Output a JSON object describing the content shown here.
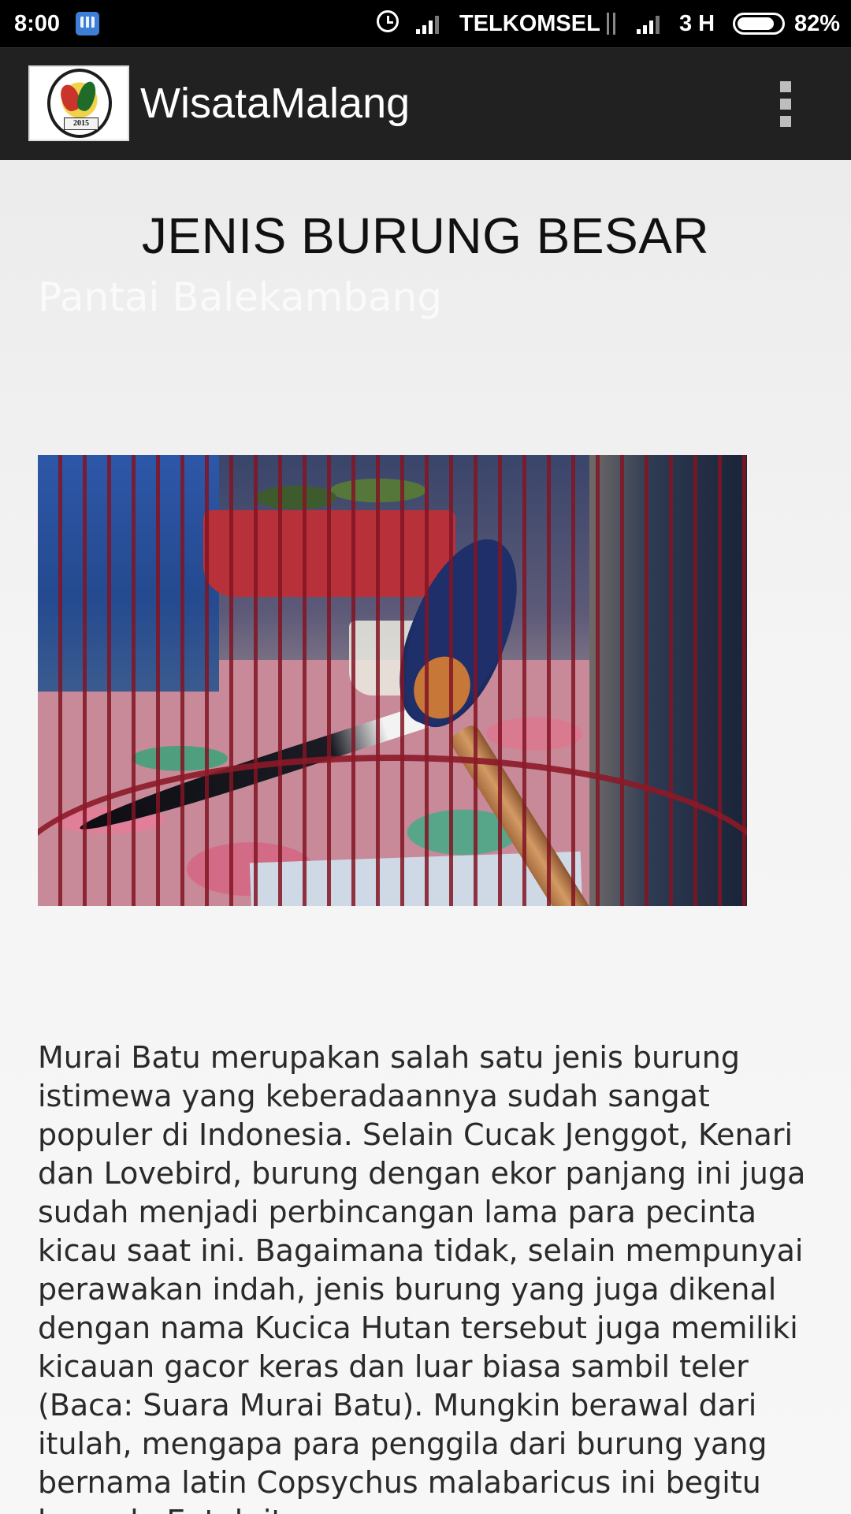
{
  "status_bar": {
    "time": "8:00",
    "carrier": "TELKOMSEL",
    "network": "3 H",
    "battery": "82%",
    "icons": [
      "bbm-icon",
      "alarm-icon",
      "signal-icon",
      "data-activity-icon",
      "signal-icon",
      "battery-icon"
    ]
  },
  "action_bar": {
    "title": "WisataMalang",
    "logo_text": "2015",
    "menu_icon": "overflow-menu-icon"
  },
  "content": {
    "title": "JENIS BURUNG BESAR",
    "subtitle": "Pantai Balekambang",
    "body": "Murai Batu merupakan salah satu jenis burung istimewa yang keberadaannya sudah sangat populer di Indonesia. Selain Cucak Jenggot, Kenari dan Lovebird, burung dengan ekor panjang ini juga sudah menjadi perbincangan lama para pecinta kicau saat ini. Bagaimana tidak, selain mempunyai perawakan indah, jenis burung yang juga dikenal dengan nama Kucica Hutan tersebut juga memiliki kicauan gacor keras dan luar biasa sambil teler (Baca: Suara Murai Batu). Mungkin berawal dari itulah, mengapa para penggila dari burung yang bernama latin Copsychus malabaricus ini begitu banyak. Entah itu"
  },
  "colors": {
    "status_bar": "#000000",
    "action_bar": "#212121",
    "background": "#f2f2f2",
    "title_text": "#111111",
    "subtitle_text": "#fafafa",
    "body_text": "#2a2a2a"
  }
}
